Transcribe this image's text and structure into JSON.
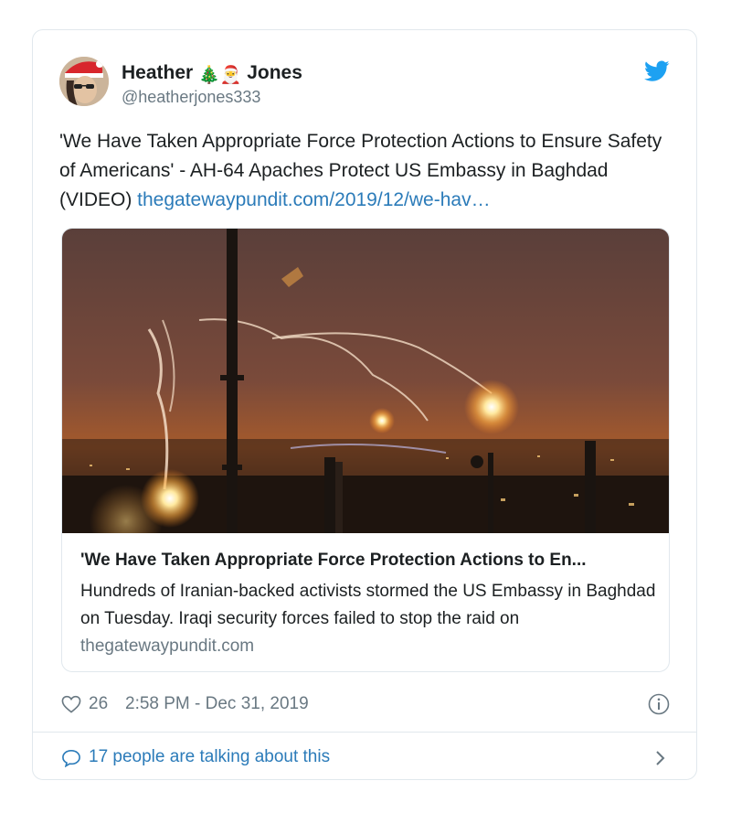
{
  "tweet": {
    "author": {
      "name_first": "Heather",
      "name_emoji": "🎄🎅",
      "name_last": "Jones",
      "handle": "@heatherjones333"
    },
    "text": "'We Have Taken Appropriate Force Protection Actions to Ensure Safety of Americans' - AH-64 Apaches Protect US Embassy in Baghdad (VIDEO) ",
    "link_text": "thegatewaypundit.com/2019/12/we-hav…",
    "card": {
      "title": "'We Have Taken Appropriate Force Protection Actions to En...",
      "description": "Hundreds of Iranian-backed activists stormed the US Embassy in Baghdad on Tuesday. Iraqi security forces failed to stop the raid on",
      "domain": "thegatewaypundit.com",
      "image_icon": "night-flares-photo"
    },
    "likes": "26",
    "timestamp": "2:58 PM - Dec 31, 2019",
    "talking": "17 people are talking about this"
  },
  "icons": {
    "brand": "twitter-bird-icon",
    "like": "heart-icon",
    "info": "info-icon",
    "reply": "speech-bubble-icon",
    "more": "chevron-right-icon"
  },
  "colors": {
    "link": "#2b7bb9",
    "brand": "#1da1f2",
    "muted": "#697882",
    "border": "#e1e8ed"
  }
}
